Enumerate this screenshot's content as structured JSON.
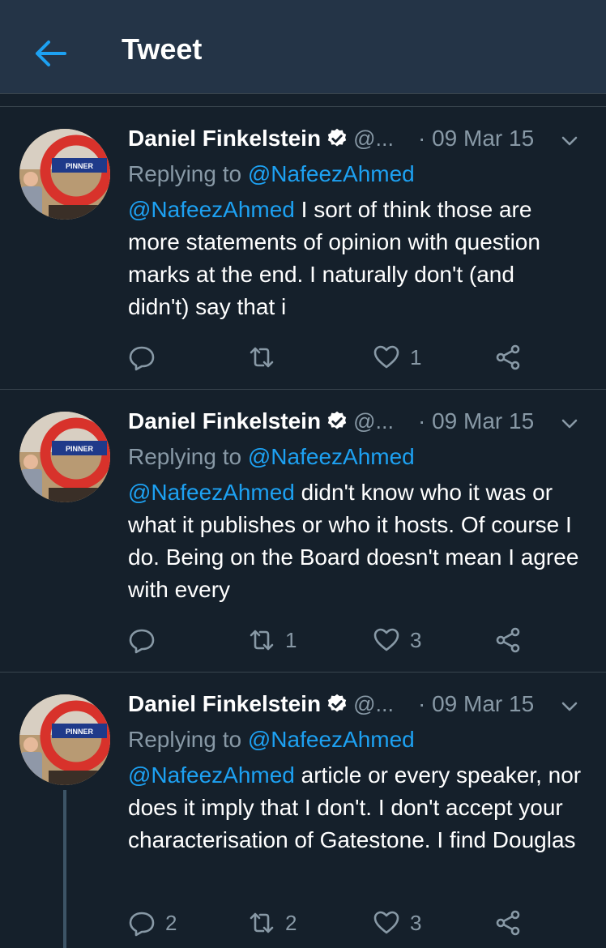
{
  "header": {
    "title": "Tweet"
  },
  "tweets": [
    {
      "name": "Daniel Finkelstein",
      "handle": "@...",
      "date": "· 09 Mar 15",
      "replying_prefix": "Replying to ",
      "replying_to": "@NafeezAhmed",
      "mention": "@NafeezAhmed",
      "text": " I sort of think those are more statements of opinion with question marks at the end. I naturally don't (and didn't) say that i",
      "avatar_sign": "PINNER",
      "reply_count": "",
      "retweet_count": "",
      "like_count": "1"
    },
    {
      "name": "Daniel Finkelstein",
      "handle": "@...",
      "date": "· 09 Mar 15",
      "replying_prefix": "Replying to ",
      "replying_to": "@NafeezAhmed",
      "mention": "@NafeezAhmed",
      "text": " didn't know who it was or what it publishes or who it hosts. Of course I do. Being on the Board doesn't mean I agree with every",
      "avatar_sign": "PINNER",
      "reply_count": "",
      "retweet_count": "1",
      "like_count": "3"
    },
    {
      "name": "Daniel Finkelstein",
      "handle": "@...",
      "date": "· 09 Mar 15",
      "replying_prefix": "Replying to ",
      "replying_to": "@NafeezAhmed",
      "mention": "@NafeezAhmed",
      "text": " article or every speaker, nor does it imply that I don't. I don't accept your characterisation of Gatestone. I find Douglas",
      "avatar_sign": "PINNER",
      "reply_count": "2",
      "retweet_count": "2",
      "like_count": "3"
    }
  ],
  "icons": {
    "back": "back-arrow-icon",
    "verified": "verified-badge-icon",
    "chevron": "chevron-down-icon",
    "reply": "reply-icon",
    "retweet": "retweet-icon",
    "like": "heart-icon",
    "share": "share-icon"
  },
  "colors": {
    "background": "#15202b",
    "header": "#243447",
    "accent": "#1da1f2",
    "secondary_text": "#8899a6",
    "divider": "#38444d"
  }
}
